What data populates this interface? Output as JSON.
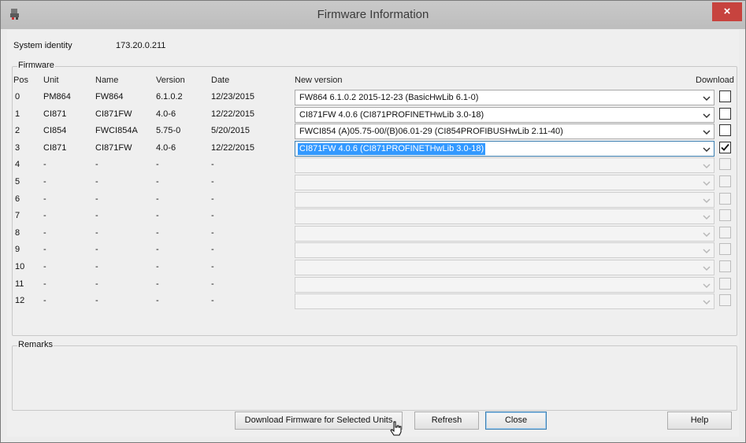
{
  "window": {
    "title": "Firmware Information",
    "close_label": "×"
  },
  "system": {
    "label": "System identity",
    "value": "173.20.0.211"
  },
  "firmware": {
    "group_label": "Firmware",
    "headers": {
      "pos": "Pos",
      "unit": "Unit",
      "name": "Name",
      "version": "Version",
      "date": "Date",
      "new_version": "New version",
      "download": "Download"
    },
    "rows": [
      {
        "pos": "0",
        "unit": "PM864",
        "name": "FW864",
        "version": "6.1.0.2",
        "date": "12/23/2015",
        "new_version": "FW864 6.1.0.2 2015-12-23 (BasicHwLib 6.1-0)",
        "enabled": true,
        "checked": false,
        "selected": false
      },
      {
        "pos": "1",
        "unit": "CI871",
        "name": "CI871FW",
        "version": "4.0-6",
        "date": "12/22/2015",
        "new_version": "CI871FW 4.0.6  (CI871PROFINETHwLib 3.0-18)",
        "enabled": true,
        "checked": false,
        "selected": false
      },
      {
        "pos": "2",
        "unit": "CI854",
        "name": "FWCI854A",
        "version": "5.75-0",
        "date": "5/20/2015",
        "new_version": "FWCI854 (A)05.75-00/(B)06.01-29  (CI854PROFIBUSHwLib 2.11-40)",
        "enabled": true,
        "checked": false,
        "selected": false
      },
      {
        "pos": "3",
        "unit": "CI871",
        "name": "CI871FW",
        "version": "4.0-6",
        "date": "12/22/2015",
        "new_version": "CI871FW 4.0.6  (CI871PROFINETHwLib 3.0-18)",
        "enabled": true,
        "checked": true,
        "selected": true
      },
      {
        "pos": "4",
        "unit": "-",
        "name": "-",
        "version": "-",
        "date": "-",
        "new_version": "",
        "enabled": false,
        "checked": false,
        "selected": false
      },
      {
        "pos": "5",
        "unit": "-",
        "name": "-",
        "version": "-",
        "date": "-",
        "new_version": "",
        "enabled": false,
        "checked": false,
        "selected": false
      },
      {
        "pos": "6",
        "unit": "-",
        "name": "-",
        "version": "-",
        "date": "-",
        "new_version": "",
        "enabled": false,
        "checked": false,
        "selected": false
      },
      {
        "pos": "7",
        "unit": "-",
        "name": "-",
        "version": "-",
        "date": "-",
        "new_version": "",
        "enabled": false,
        "checked": false,
        "selected": false
      },
      {
        "pos": "8",
        "unit": "-",
        "name": "-",
        "version": "-",
        "date": "-",
        "new_version": "",
        "enabled": false,
        "checked": false,
        "selected": false
      },
      {
        "pos": "9",
        "unit": "-",
        "name": "-",
        "version": "-",
        "date": "-",
        "new_version": "",
        "enabled": false,
        "checked": false,
        "selected": false
      },
      {
        "pos": "10",
        "unit": "-",
        "name": "-",
        "version": "-",
        "date": "-",
        "new_version": "",
        "enabled": false,
        "checked": false,
        "selected": false
      },
      {
        "pos": "11",
        "unit": "-",
        "name": "-",
        "version": "-",
        "date": "-",
        "new_version": "",
        "enabled": false,
        "checked": false,
        "selected": false
      },
      {
        "pos": "12",
        "unit": "-",
        "name": "-",
        "version": "-",
        "date": "-",
        "new_version": "",
        "enabled": false,
        "checked": false,
        "selected": false
      }
    ]
  },
  "remarks": {
    "label": "Remarks"
  },
  "buttons": {
    "download": "Download Firmware for Selected Units",
    "refresh": "Refresh",
    "close": "Close",
    "help": "Help"
  },
  "icons": {
    "app": "app-icon",
    "combo_arrow": "chevron-down-icon",
    "check": "checkmark-icon",
    "cursor": "hand-cursor-icon"
  },
  "colors": {
    "title_close": "#c7433e",
    "selection": "#3399ff",
    "focus_border": "#3c7fb1"
  }
}
